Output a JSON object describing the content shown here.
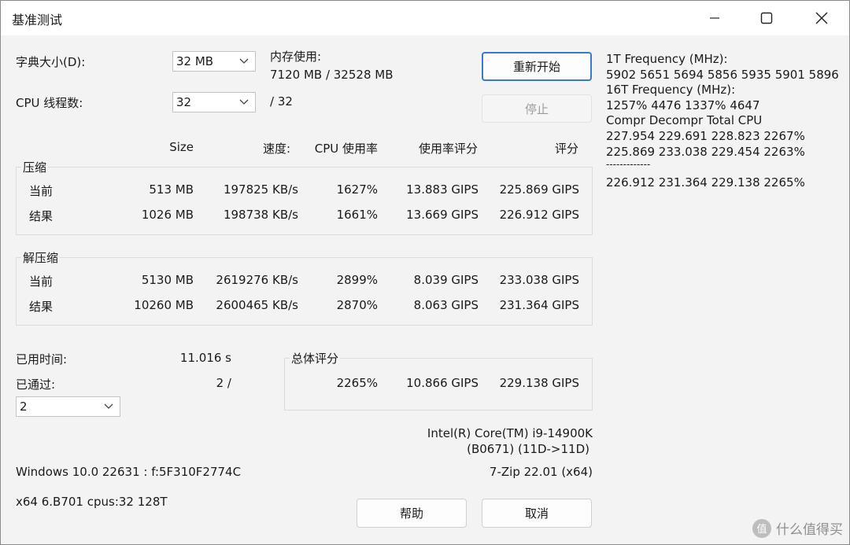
{
  "window": {
    "title": "基准测试",
    "controls": {
      "minimize": "minimize",
      "maximize": "maximize",
      "close": "close"
    }
  },
  "settings": {
    "dict_label": "字典大小(D):",
    "dict_value": "32 MB",
    "threads_label": "CPU 线程数:",
    "threads_value": "32",
    "threads_max": "/ 32",
    "memory_label": "内存使用:",
    "memory_value": "7120 MB / 32528 MB"
  },
  "buttons": {
    "restart": "重新开始",
    "stop": "停止",
    "help": "帮助",
    "cancel": "取消"
  },
  "table_headers": {
    "size": "Size",
    "speed": "速度:",
    "cpu_usage": "CPU 使用率",
    "usage_rating": "使用率评分",
    "rating": "评分"
  },
  "compress": {
    "title": "压缩",
    "rows": [
      {
        "label": "当前",
        "size": "513 MB",
        "speed": "197825 KB/s",
        "cpu": "1627%",
        "usage_rating": "13.883 GIPS",
        "rating": "225.869 GIPS"
      },
      {
        "label": "结果",
        "size": "1026 MB",
        "speed": "198738 KB/s",
        "cpu": "1661%",
        "usage_rating": "13.669 GIPS",
        "rating": "226.912 GIPS"
      }
    ]
  },
  "decompress": {
    "title": "解压缩",
    "rows": [
      {
        "label": "当前",
        "size": "5130 MB",
        "speed": "2619276 KB/s",
        "cpu": "2899%",
        "usage_rating": "8.039 GIPS",
        "rating": "233.038 GIPS"
      },
      {
        "label": "结果",
        "size": "10260 MB",
        "speed": "2600465 KB/s",
        "cpu": "2870%",
        "usage_rating": "8.063 GIPS",
        "rating": "231.364 GIPS"
      }
    ]
  },
  "status": {
    "elapsed_label": "已用时间:",
    "elapsed_value": "11.016 s",
    "passes_label": "已通过:",
    "passes_value": "2 /",
    "passes_select": "2"
  },
  "total": {
    "title": "总体评分",
    "cpu": "2265%",
    "usage_rating": "10.866 GIPS",
    "rating": "229.138 GIPS"
  },
  "system": {
    "cpu_name": "Intel(R) Core(TM) i9-14900K",
    "cpu_id": "(B0671) (11D->11D)",
    "os": "Windows 10.0 22631 :  f:5F310F2774C",
    "version": "7-Zip 22.01 (x64)",
    "arch": "x64 6.B701 cpus:32 128T"
  },
  "log": {
    "lines": [
      "1T Frequency (MHz):",
      " 5902 5651 5694 5856 5935 5901 5896",
      "16T Frequency (MHz):",
      " 1257% 4476 1337% 4647",
      "Compr Decompr Total   CPU",
      "227.954  229.691  228.823  2267%",
      "225.869  233.038  229.454  2263%",
      "-------------",
      "226.912  231.364  229.138  2265%"
    ]
  },
  "watermark": {
    "badge": "值",
    "text": "什么值得买"
  }
}
